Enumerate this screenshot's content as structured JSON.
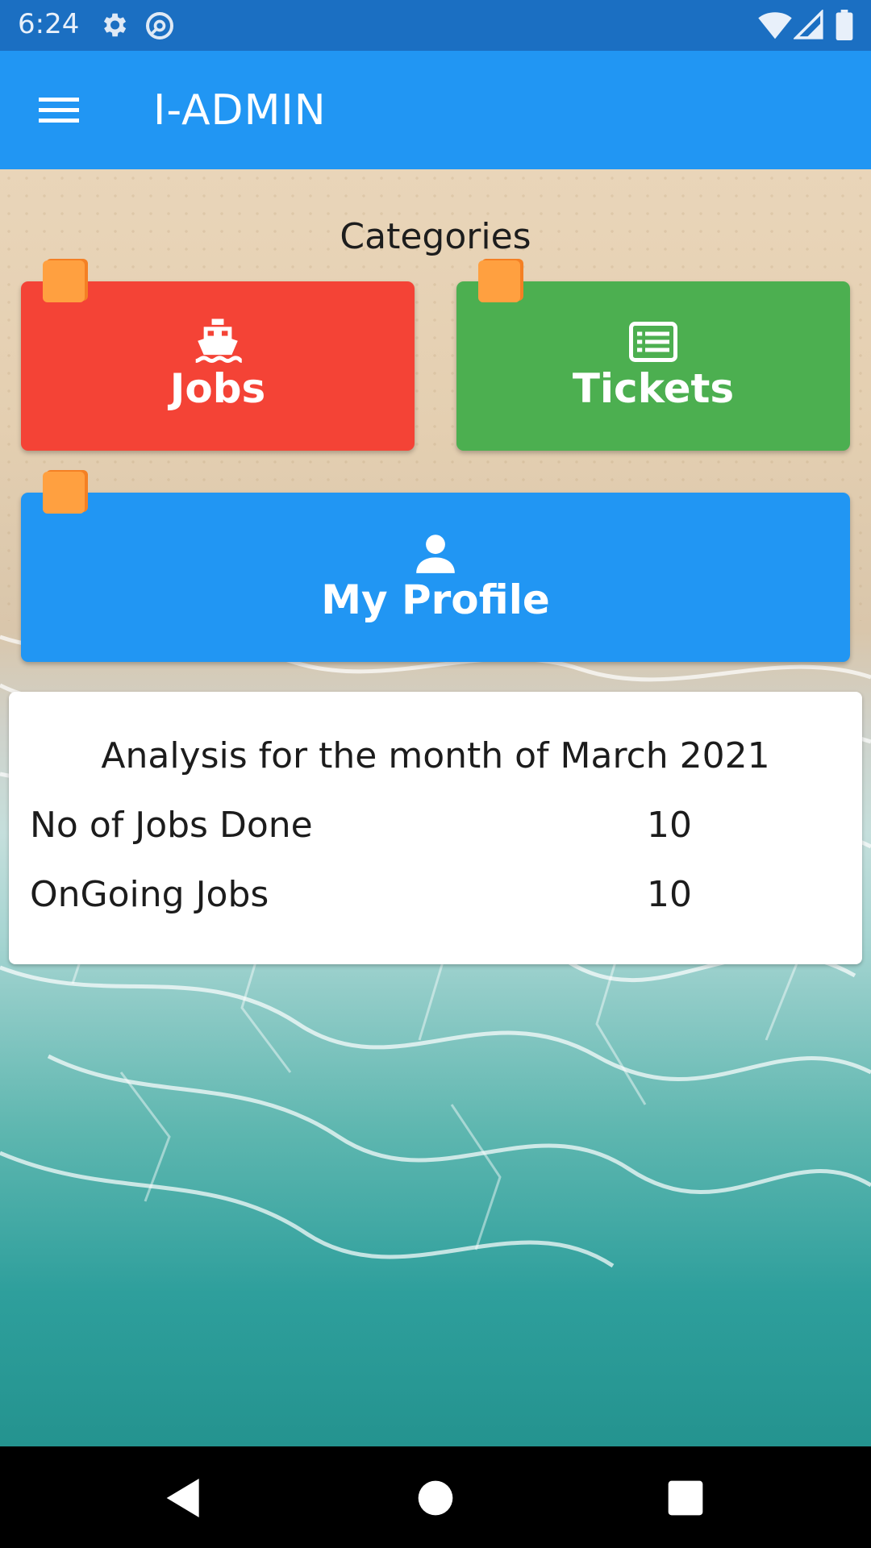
{
  "status_bar": {
    "time": "6:24",
    "icons": [
      "gear-icon",
      "at-sign-icon",
      "wifi-icon",
      "signal-icon",
      "battery-icon"
    ]
  },
  "app_bar": {
    "title": "I-ADMIN",
    "menu_icon": "menu-icon"
  },
  "categories": {
    "title": "Categories",
    "items": [
      {
        "label": "Jobs",
        "icon": "ship-icon",
        "color": "#f44336"
      },
      {
        "label": "Tickets",
        "icon": "list-icon",
        "color": "#4caf50"
      },
      {
        "label": "My Profile",
        "icon": "person-icon",
        "color": "#2196f3"
      }
    ]
  },
  "analysis": {
    "title": "Analysis for the month of March 2021",
    "rows": [
      {
        "label": "No of Jobs Done",
        "value": "10"
      },
      {
        "label": "OnGoing Jobs",
        "value": "10"
      }
    ]
  },
  "nav_bar": {
    "buttons": [
      "back-icon",
      "home-icon",
      "recents-icon"
    ]
  },
  "colors": {
    "app_bar": "#2196f3",
    "status_bar": "#1b6fc2",
    "flag": "#ffa040"
  }
}
